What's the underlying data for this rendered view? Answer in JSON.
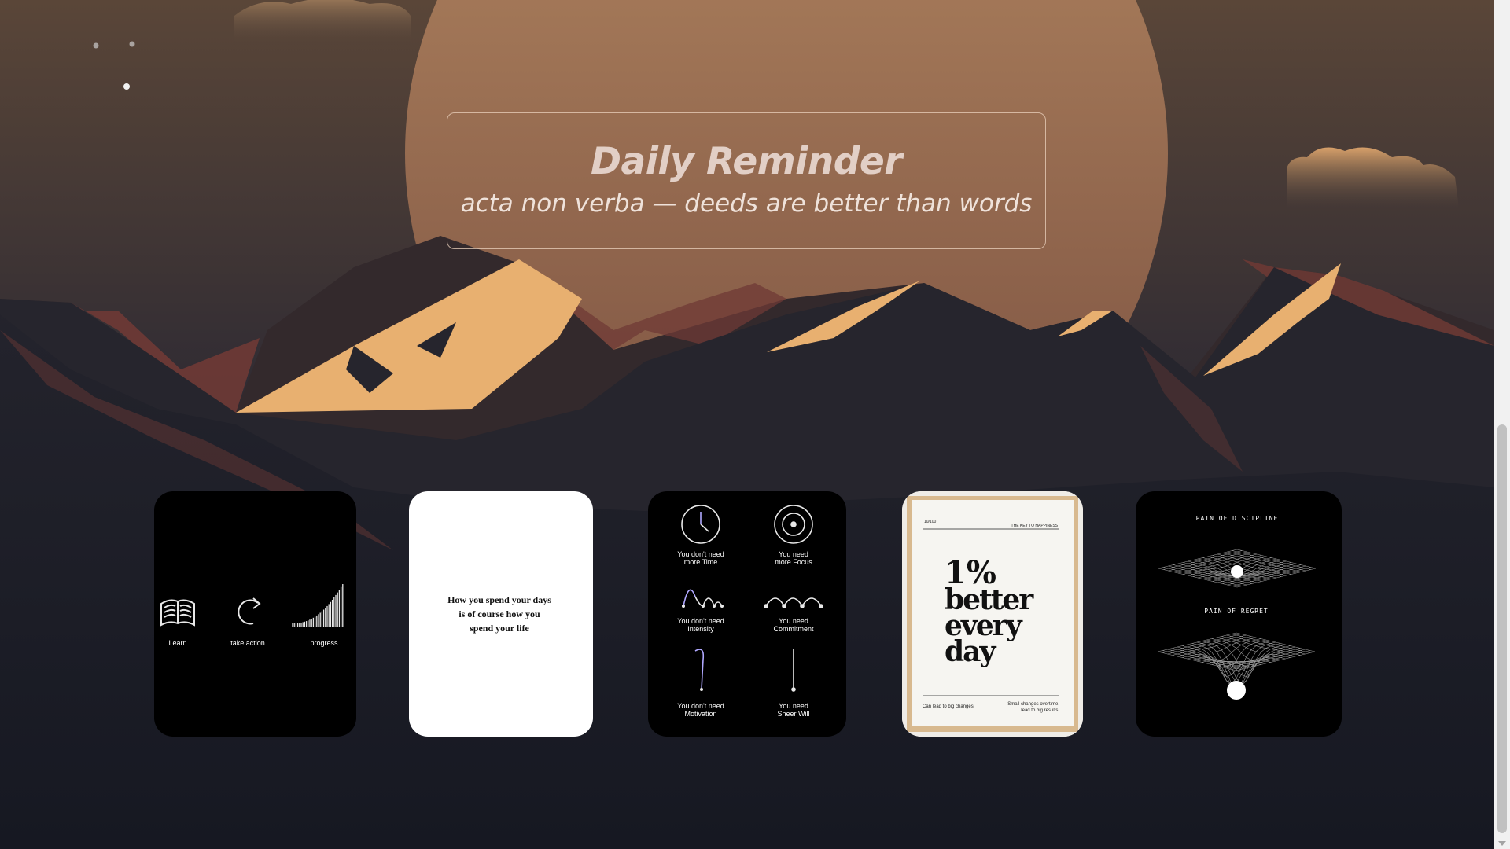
{
  "reminder": {
    "title": "Daily Reminder",
    "subtitle": "acta non verba — deeds are better than words"
  },
  "cards": {
    "learn": {
      "labels": [
        "Learn",
        "take action",
        "progress"
      ]
    },
    "quote": {
      "lines": [
        "How you spend your days",
        "is of course how you",
        "spend your life"
      ]
    },
    "needs": {
      "items": [
        [
          "You don't need",
          "more Time"
        ],
        [
          "You need",
          "more Focus"
        ],
        [
          "You don't need",
          "Intensity"
        ],
        [
          "You need",
          "Commitment"
        ],
        [
          "You don't need",
          "Motivation"
        ],
        [
          "You need",
          "Sheer Will"
        ]
      ]
    },
    "better": {
      "corner_left": "10/100",
      "corner_right": "THE KEY TO HAPPINESS",
      "headline": [
        "1%",
        "better",
        "every",
        "day"
      ],
      "footer_left": "Can lead to big changes.",
      "footer_right": [
        "Small changes overtime,",
        "lead to big results."
      ]
    },
    "discipline": {
      "top_label": "PAIN OF DISCIPLINE",
      "bottom_label": "PAIN OF REGRET"
    }
  },
  "colors": {
    "sun": "#a87654",
    "peak_highlight": "#e8b070",
    "mountain_dark": "#26252d",
    "sky_bottom": "#12151f",
    "ridge_red": "#7a3a34"
  },
  "icons": [
    "book-icon",
    "refresh-icon",
    "progress-bars-icon",
    "clock-icon",
    "target-icon",
    "bounce-icon",
    "arches-icon",
    "cane-icon",
    "line-icon"
  ]
}
